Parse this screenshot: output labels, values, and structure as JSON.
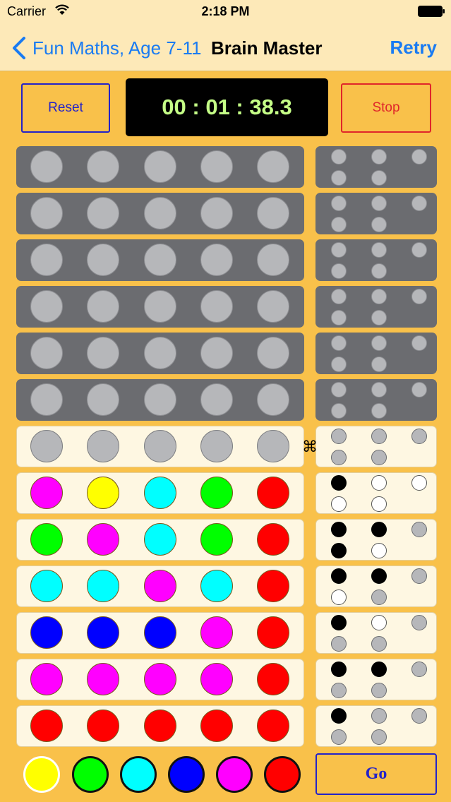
{
  "status": {
    "carrier": "Carrier",
    "time": "2:18 PM"
  },
  "nav": {
    "back_label": "Fun Maths, Age 7-11",
    "title": "Brain Master",
    "retry_label": "Retry"
  },
  "controls": {
    "reset_label": "Reset",
    "stop_label": "Stop",
    "timer": "00 : 01 : 38.3",
    "go_label": "Go",
    "cmd_glyph": "⌘"
  },
  "colors": {
    "magenta": "#ff00ff",
    "yellow": "#ffff00",
    "cyan": "#00ffff",
    "green": "#00ff00",
    "red": "#ff0000",
    "blue": "#0000ff",
    "accent_blue": "#1a7bf2",
    "background": "#f9c14a"
  },
  "board": {
    "rows": [
      {
        "state": "locked",
        "pegs": [
          "empty",
          "empty",
          "empty",
          "empty",
          "empty"
        ],
        "feedback": [
          "empty",
          "empty",
          "empty",
          "empty",
          "empty"
        ]
      },
      {
        "state": "locked",
        "pegs": [
          "empty",
          "empty",
          "empty",
          "empty",
          "empty"
        ],
        "feedback": [
          "empty",
          "empty",
          "empty",
          "empty",
          "empty"
        ]
      },
      {
        "state": "locked",
        "pegs": [
          "empty",
          "empty",
          "empty",
          "empty",
          "empty"
        ],
        "feedback": [
          "empty",
          "empty",
          "empty",
          "empty",
          "empty"
        ]
      },
      {
        "state": "locked",
        "pegs": [
          "empty",
          "empty",
          "empty",
          "empty",
          "empty"
        ],
        "feedback": [
          "empty",
          "empty",
          "empty",
          "empty",
          "empty"
        ]
      },
      {
        "state": "locked",
        "pegs": [
          "empty",
          "empty",
          "empty",
          "empty",
          "empty"
        ],
        "feedback": [
          "empty",
          "empty",
          "empty",
          "empty",
          "empty"
        ]
      },
      {
        "state": "locked",
        "pegs": [
          "empty",
          "empty",
          "empty",
          "empty",
          "empty"
        ],
        "feedback": [
          "empty",
          "empty",
          "empty",
          "empty",
          "empty"
        ]
      },
      {
        "state": "active",
        "pegs": [
          "empty",
          "empty",
          "empty",
          "empty",
          "empty"
        ],
        "feedback": [
          "empty",
          "empty",
          "empty",
          "empty",
          "empty"
        ]
      },
      {
        "state": "played",
        "pegs": [
          "magenta",
          "yellow",
          "cyan",
          "green",
          "red"
        ],
        "feedback": [
          "black",
          "white",
          "white",
          "white",
          "white"
        ]
      },
      {
        "state": "played",
        "pegs": [
          "green",
          "magenta",
          "cyan",
          "green",
          "red"
        ],
        "feedback": [
          "black",
          "black",
          "empty",
          "black",
          "white"
        ]
      },
      {
        "state": "played",
        "pegs": [
          "cyan",
          "cyan",
          "magenta",
          "cyan",
          "red"
        ],
        "feedback": [
          "black",
          "black",
          "empty",
          "white",
          "empty"
        ]
      },
      {
        "state": "played",
        "pegs": [
          "blue",
          "blue",
          "blue",
          "magenta",
          "red"
        ],
        "feedback": [
          "black",
          "white",
          "empty",
          "empty",
          "empty"
        ]
      },
      {
        "state": "played",
        "pegs": [
          "magenta",
          "magenta",
          "magenta",
          "magenta",
          "red"
        ],
        "feedback": [
          "black",
          "black",
          "empty",
          "empty",
          "empty"
        ]
      },
      {
        "state": "played",
        "pegs": [
          "red",
          "red",
          "red",
          "red",
          "red"
        ],
        "feedback": [
          "black",
          "empty",
          "empty",
          "empty",
          "empty"
        ]
      }
    ]
  },
  "palette": [
    {
      "color": "yellow",
      "selected": true
    },
    {
      "color": "green",
      "selected": false
    },
    {
      "color": "cyan",
      "selected": false
    },
    {
      "color": "blue",
      "selected": false
    },
    {
      "color": "magenta",
      "selected": false
    },
    {
      "color": "red",
      "selected": false
    }
  ]
}
